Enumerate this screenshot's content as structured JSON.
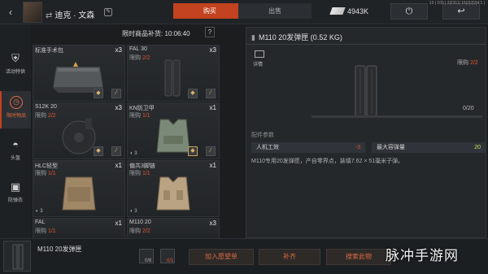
{
  "header": {
    "player_name": "迪克 · 文森",
    "tabs": [
      {
        "label": "购买",
        "active": true
      },
      {
        "label": "出售",
        "active": false
      }
    ],
    "currency_amount": "4943K",
    "status_text": "13 | 100 | 2|2311| 16|2|2|2|4:1 |"
  },
  "sidebar": {
    "items": [
      {
        "label": "活动特供",
        "icon": "medal-icon",
        "active": false
      },
      {
        "label": "限时物品",
        "icon": "clock-icon",
        "active": true
      },
      {
        "label": "头盔",
        "icon": "helmet-icon",
        "active": false
      },
      {
        "label": "防弹衣",
        "icon": "vest-icon",
        "active": false
      }
    ]
  },
  "shop": {
    "restock_label": "限时商品补货: 10:06:40",
    "help_label": "?",
    "items": [
      {
        "name": "标准手术包",
        "limit_prefix": "",
        "limit": "",
        "qty": "x3"
      },
      {
        "name": "FAL 30",
        "limit_prefix": "限购 ",
        "limit": "2/2",
        "qty": "x3"
      },
      {
        "name": "S12K 20",
        "limit_prefix": "限购 ",
        "limit": "2/2",
        "qty": "x3"
      },
      {
        "name": "KN防卫甲",
        "limit_prefix": "限购 ",
        "limit": "1/1",
        "qty": "x1"
      },
      {
        "name": "HLC轻型",
        "limit_prefix": "限购 ",
        "limit": "1/1",
        "qty": "x1"
      },
      {
        "name": "偏共3脚链",
        "limit_prefix": "限购 ",
        "limit": "1/1",
        "qty": "x1"
      },
      {
        "name": "FAL",
        "limit_prefix": "限购 ",
        "limit": "1/1",
        "qty": "x1"
      },
      {
        "name": "M110 20",
        "limit_prefix": "限购 ",
        "limit": "2/2",
        "qty": "x3"
      }
    ],
    "stack_counts": [
      "3",
      "3",
      "3",
      "3"
    ]
  },
  "detail": {
    "title": "M110 20发弹匣 (0.52 KG)",
    "icon_label": "详情",
    "limit_prefix": "限购 ",
    "limit": "2/2",
    "stock": "0/20",
    "props_title": "配件参数",
    "props": [
      {
        "key": "人机工效",
        "value": "-3"
      },
      {
        "key": "最大容弹量",
        "value": "20"
      }
    ],
    "description": "M110专用20发弹匣，产自零界点，装填7.62 × 51毫米子弹。"
  },
  "bottom": {
    "item_name": "M110 20发弹匣",
    "count_a": "0/8",
    "count_b": "0/1",
    "wishlist_label": "加入愿望单",
    "refill_label": "补齐",
    "search_label": "搜索此物"
  },
  "watermark": "脉冲手游网",
  "colors": {
    "accent": "#c3421f",
    "limit_red": "#e1542d",
    "positive_green": "#cbe35a"
  }
}
